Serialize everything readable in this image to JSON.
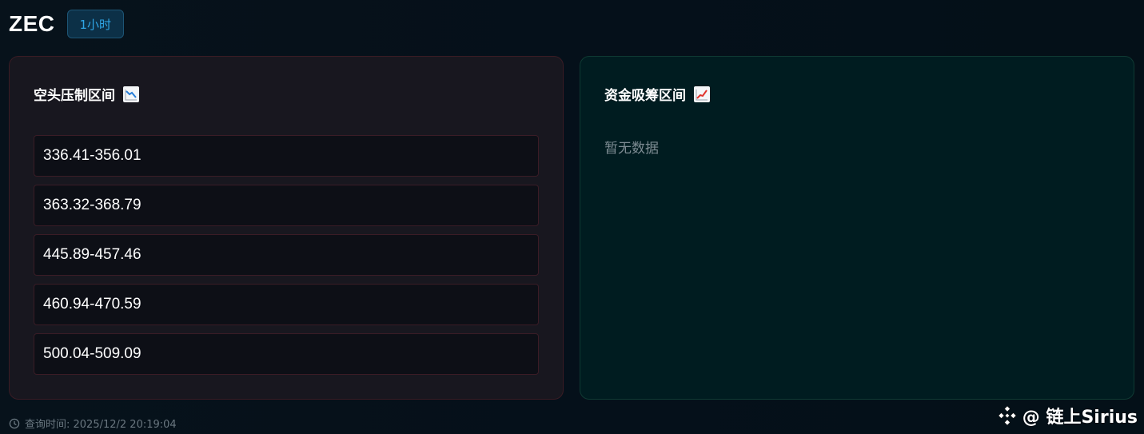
{
  "header": {
    "symbol": "ZEC",
    "timeframe": "1小时"
  },
  "bear_panel": {
    "title": "空头压制区间",
    "icon": "chart-decreasing-icon",
    "zones": [
      "336.41-356.01",
      "363.32-368.79",
      "445.89-457.46",
      "460.94-470.59",
      "500.04-509.09"
    ]
  },
  "bull_panel": {
    "title": "资金吸筹区间",
    "icon": "chart-increasing-icon",
    "empty_text": "暂无数据"
  },
  "footer": {
    "query_time": "查询时间: 2025/12/2 20:19:04",
    "icon": "clock-icon"
  },
  "watermark": {
    "text": "@ 链上Sirius",
    "icon": "binance-logo-icon"
  },
  "colors": {
    "background": "#06111b",
    "bear_panel_bg": "#18171f",
    "bull_panel_bg": "#001c20",
    "timeframe_accent": "#2fa6e6",
    "bear_border": "#3a1c24"
  }
}
